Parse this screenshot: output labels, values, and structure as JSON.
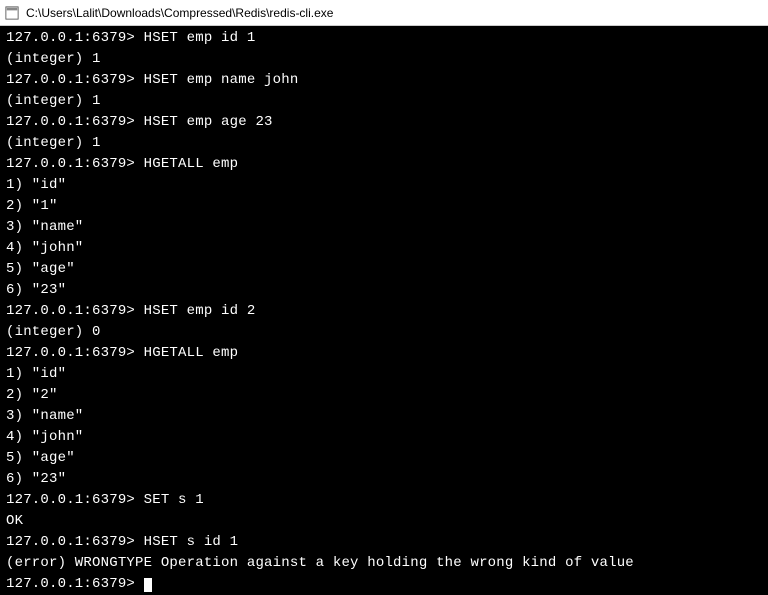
{
  "titlebar": {
    "path": "C:\\Users\\Lalit\\Downloads\\Compressed\\Redis\\redis-cli.exe"
  },
  "prompt": "127.0.0.1:6379> ",
  "lines": [
    {
      "type": "cmd",
      "text": "HSET emp id 1"
    },
    {
      "type": "out",
      "text": "(integer) 1"
    },
    {
      "type": "cmd",
      "text": "HSET emp name john"
    },
    {
      "type": "out",
      "text": "(integer) 1"
    },
    {
      "type": "cmd",
      "text": "HSET emp age 23"
    },
    {
      "type": "out",
      "text": "(integer) 1"
    },
    {
      "type": "cmd",
      "text": "HGETALL emp"
    },
    {
      "type": "out",
      "text": "1) \"id\""
    },
    {
      "type": "out",
      "text": "2) \"1\""
    },
    {
      "type": "out",
      "text": "3) \"name\""
    },
    {
      "type": "out",
      "text": "4) \"john\""
    },
    {
      "type": "out",
      "text": "5) \"age\""
    },
    {
      "type": "out",
      "text": "6) \"23\""
    },
    {
      "type": "cmd",
      "text": "HSET emp id 2"
    },
    {
      "type": "out",
      "text": "(integer) 0"
    },
    {
      "type": "cmd",
      "text": "HGETALL emp"
    },
    {
      "type": "out",
      "text": "1) \"id\""
    },
    {
      "type": "out",
      "text": "2) \"2\""
    },
    {
      "type": "out",
      "text": "3) \"name\""
    },
    {
      "type": "out",
      "text": "4) \"john\""
    },
    {
      "type": "out",
      "text": "5) \"age\""
    },
    {
      "type": "out",
      "text": "6) \"23\""
    },
    {
      "type": "cmd",
      "text": "SET s 1"
    },
    {
      "type": "out",
      "text": "OK"
    },
    {
      "type": "cmd",
      "text": "HSET s id 1"
    },
    {
      "type": "out",
      "text": "(error) WRONGTYPE Operation against a key holding the wrong kind of value"
    }
  ]
}
